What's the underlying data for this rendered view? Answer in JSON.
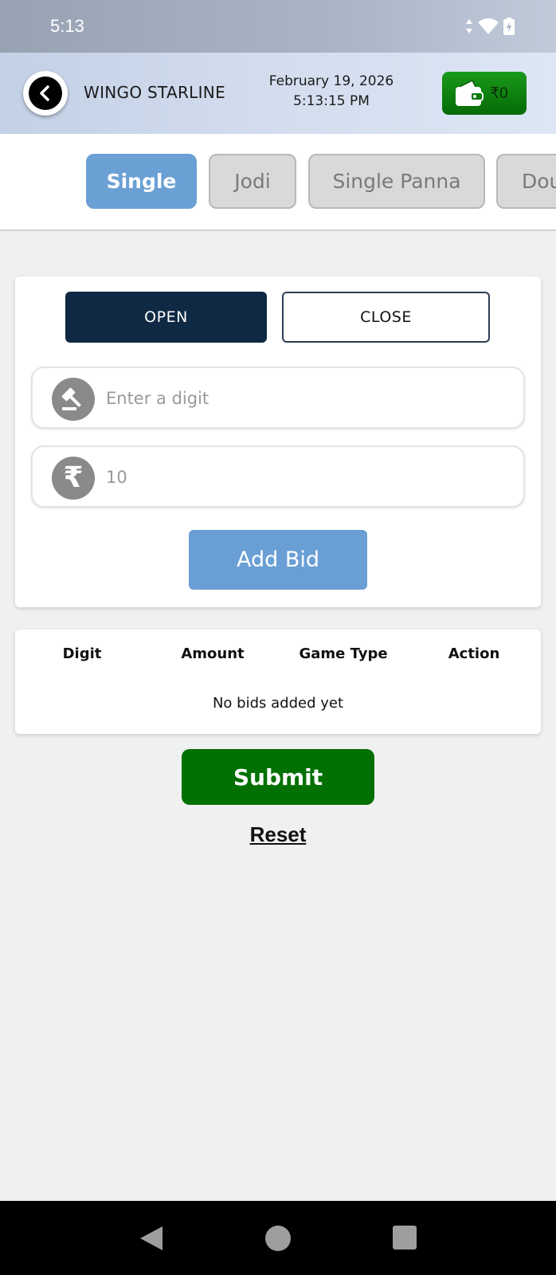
{
  "status_bar": {
    "time": "5:13"
  },
  "header": {
    "title": "WINGO STARLINE",
    "date": "February 19, 2026",
    "time": "5:13:15 PM",
    "wallet_amount": "₹0"
  },
  "tabs": [
    {
      "label": "Single",
      "active": true
    },
    {
      "label": "Jodi",
      "active": false
    },
    {
      "label": "Single Panna",
      "active": false
    },
    {
      "label": "Dou",
      "active": false
    }
  ],
  "session": {
    "open_label": "OPEN",
    "close_label": "CLOSE",
    "selected": "OPEN"
  },
  "digit_input": {
    "placeholder": "Enter a digit",
    "value": ""
  },
  "amount_input": {
    "placeholder": "10",
    "value": ""
  },
  "add_bid_label": "Add Bid",
  "bids_table": {
    "columns": [
      "Digit",
      "Amount",
      "Game Type",
      "Action"
    ],
    "rows": [],
    "empty_message": "No bids added yet"
  },
  "submit_label": "Submit",
  "reset_label": "Reset",
  "colors": {
    "primary_blue": "#6aa0d4",
    "navy": "#0f2944",
    "submit_green": "#037003",
    "wallet_green": "#1a9a1a"
  },
  "icons": [
    "back-arrow-icon",
    "wallet-icon",
    "gavel-icon",
    "rupee-icon",
    "nav-back-icon",
    "nav-home-icon",
    "nav-recents-icon",
    "wifi-icon",
    "battery-icon",
    "data-arrows-icon"
  ]
}
